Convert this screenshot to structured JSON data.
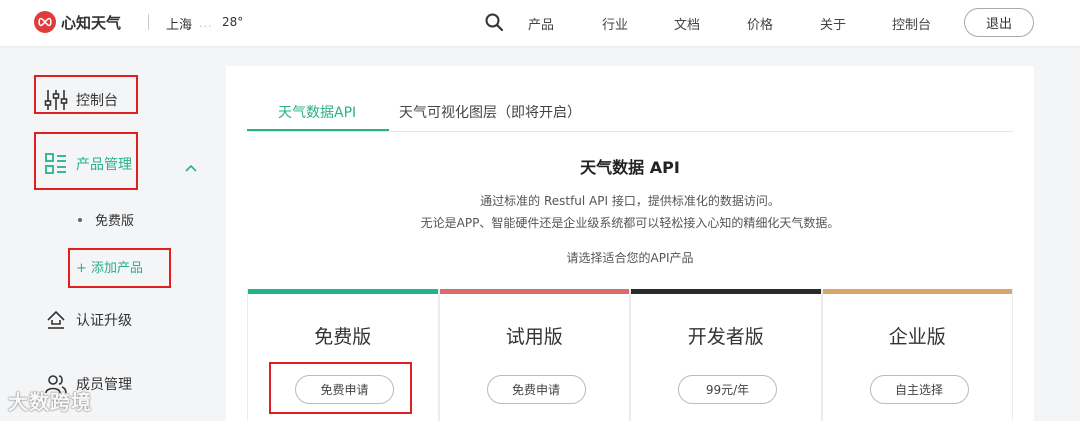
{
  "header": {
    "brand": "心知天气",
    "city": "上海",
    "weather_dots": "...",
    "temperature": "28°",
    "nav": [
      "产品",
      "行业",
      "文档",
      "价格",
      "关于",
      "控制台"
    ],
    "logout": "退出"
  },
  "sidebar": {
    "items": [
      {
        "label": "控制台",
        "icon": "sliders-icon"
      },
      {
        "label": "产品管理",
        "icon": "list-icon",
        "active": true
      },
      {
        "label": "免费版",
        "sub": true
      },
      {
        "label": "+ 添加产品",
        "sub": true,
        "accent": true
      },
      {
        "label": "认证升级",
        "icon": "upload-icon"
      },
      {
        "label": "成员管理",
        "icon": "users-icon"
      }
    ]
  },
  "main": {
    "tabs": [
      "天气数据API",
      "天气可视化图层（即将开启）"
    ],
    "title": "天气数据 API",
    "desc_line1": "通过标准的 Restful API 接口，提供标准化的数据访问。",
    "desc_line2": "无论是APP、智能硬件还是企业级系统都可以轻松接入心知的精细化天气数据。",
    "prompt": "请选择适合您的API产品",
    "cards": [
      {
        "name": "免费版",
        "button": "免费申请",
        "color": "#1fb68b"
      },
      {
        "name": "试用版",
        "button": "免费申请",
        "color": "#d96b6b"
      },
      {
        "name": "开发者版",
        "button": "99元/年",
        "color": "#2b2b2b"
      },
      {
        "name": "企业版",
        "button": "自主选择",
        "color": "#d8a66c"
      }
    ]
  },
  "watermark": "大数跨境",
  "colors": {
    "accent": "#27b18a",
    "highlight": "#e02020",
    "brand": "#e03c3c"
  }
}
